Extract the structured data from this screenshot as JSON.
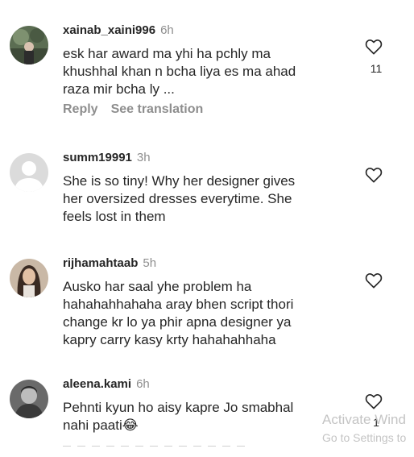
{
  "comments": [
    {
      "username": "xainab_xaini996",
      "time": "6h",
      "text": "esk har award ma yhi ha pchly ma\nkhushhal khan n bcha liya es ma ahad\nraza mir bcha ly ...",
      "like_count": "11",
      "reply_label": "Reply",
      "translate_label": "See translation",
      "avatar_icon": "avatar-photo-icon"
    },
    {
      "username": "summ19991",
      "time": "3h",
      "text": "She is so tiny! Why her designer gives\nher oversized dresses everytime. She\nfeels lost in them",
      "avatar_icon": "default-avatar-icon"
    },
    {
      "username": "rijhamahtaab",
      "time": "5h",
      "text": "Ausko har saal yhe problem ha\nhahahahhahaha aray bhen script thori\nchange kr lo ya phir apna designer ya\nkapry carry kasy krty hahahahhaha",
      "avatar_icon": "avatar-photo-icon"
    },
    {
      "username": "aleena.kami",
      "time": "6h",
      "text": "Pehnti kyun ho aisy kapre Jo smabhal\nnahi paati😂",
      "like_count": "1",
      "avatar_icon": "avatar-photo-icon"
    }
  ],
  "watermark": {
    "title": "Activate Wind",
    "subtitle": "Go to Settings to"
  },
  "colors": {
    "text": "#262626",
    "muted": "#8e8e8e",
    "watermark": "#c4c4c4"
  }
}
